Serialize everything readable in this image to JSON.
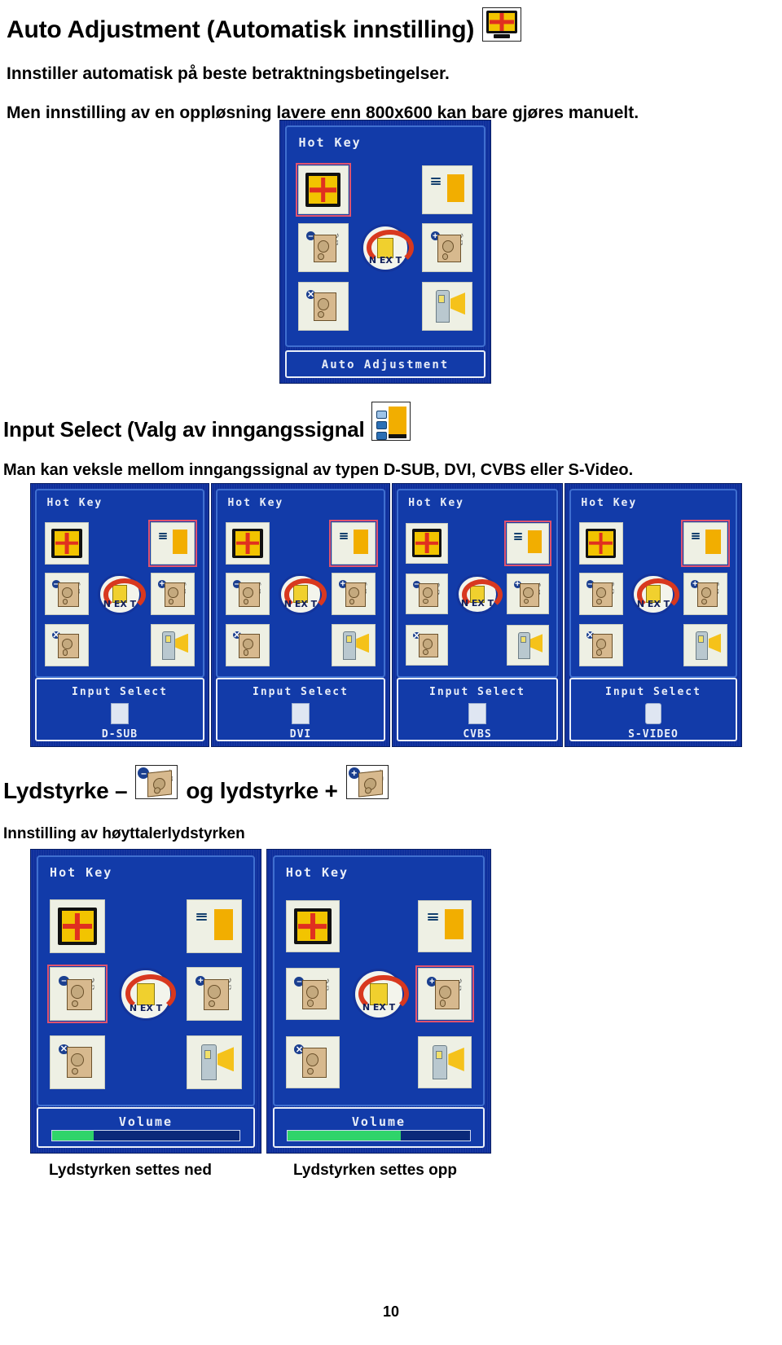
{
  "page": {
    "number": "10",
    "language": "no"
  },
  "sections": [
    {
      "id": "auto-adjustment",
      "heading": "Auto Adjustment (Automatisk innstilling)",
      "heading_icon": "auto-adjust-monitor-icon",
      "paragraphs": [
        "Innstiller automatisk på beste betraktningsbetingelser.",
        "Men innstilling av en oppløsning lavere enn 800x600 kan bare gjøres manuelt."
      ]
    },
    {
      "id": "input-select",
      "heading": "Input Select (Valg av inngangssignal",
      "heading_icon": "input-select-icon",
      "paragraphs": [
        "Man kan veksle mellom inngangssignal av typen D-SUB, DVI, CVBS eller S-Video."
      ]
    },
    {
      "id": "volume",
      "heading_parts": {
        "before": "Lydstyrke –",
        "middle": "og lydstyrke +"
      },
      "icon_minus": "volume-down-speaker-icon",
      "icon_plus": "volume-up-speaker-icon",
      "paragraphs": [
        "Innstilling av høyttalerlydstyrken"
      ]
    }
  ],
  "osd": {
    "hotkey_title": "Hot Key",
    "icons": {
      "auto": "auto-adjust-monitor-icon",
      "input": "input-select-icon",
      "vol_down": "volume-down-speaker-icon",
      "vol_up": "volume-up-speaker-icon",
      "mute": "mute-speaker-icon",
      "brightness": "brightness-lighthouse-icon",
      "next": "next-exit-icon"
    },
    "next_label_top": "N",
    "next_label_t": "T",
    "next_label_ex": "EX",
    "badges": {
      "minus": "–",
      "plus": "+",
      "mute": "✕"
    }
  },
  "screens": {
    "auto_adjustment": {
      "name": "auto-adjustment-osd",
      "hotkey": "Hot Key",
      "status_label": "Auto Adjustment",
      "selected": "auto"
    },
    "input_select": [
      {
        "name": "input-select-dsub-osd",
        "hotkey": "Hot Key",
        "status_label": "Input Select",
        "value": "D-SUB",
        "connector_icon": "dsub-connector-icon",
        "selected": "input"
      },
      {
        "name": "input-select-dvi-osd",
        "hotkey": "Hot Key",
        "status_label": "Input Select",
        "value": "DVI",
        "connector_icon": "dvi-connector-icon",
        "selected": "input"
      },
      {
        "name": "input-select-cvbs-osd",
        "hotkey": "Hot Key",
        "status_label": "Input Select",
        "value": "CVBS",
        "connector_icon": "cvbs-connector-icon",
        "selected": "input"
      },
      {
        "name": "input-select-svideo-osd",
        "hotkey": "Hot Key",
        "status_label": "Input Select",
        "value": "S-VIDEO",
        "connector_icon": "svideo-connector-icon",
        "selected": "input"
      }
    ],
    "volume": [
      {
        "name": "volume-down-osd",
        "hotkey": "Hot Key",
        "status_label": "Volume",
        "caption": "Lydstyrken settes ned",
        "level_percent": 22,
        "selected": "vol_down"
      },
      {
        "name": "volume-up-osd",
        "hotkey": "Hot Key",
        "status_label": "Volume",
        "caption": "Lydstyrken settes opp",
        "level_percent": 62,
        "selected": "vol_up"
      }
    ]
  },
  "colors": {
    "osd_blue": "#123ba9",
    "osd_blue_dark": "#0e2f9c",
    "osd_text": "#e9eef8",
    "highlight": "#e0536e",
    "accent_yellow": "#f2c400",
    "accent_red": "#e03020",
    "volume_green": "#2fd46a"
  }
}
